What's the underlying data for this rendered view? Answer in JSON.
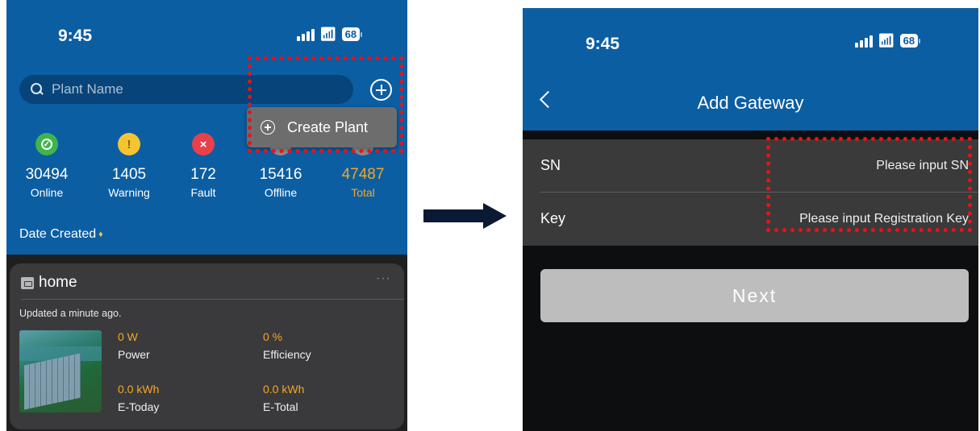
{
  "colors": {
    "brand_blue": "#0c5ea3",
    "online": "#3db54a",
    "warning": "#f4c531",
    "fault": "#e8404b",
    "total_accent": "#f5a623",
    "highlight": "#e8121c"
  },
  "plant_list": {
    "status_bar": {
      "time": "9:45",
      "battery": "68"
    },
    "search": {
      "placeholder": "Plant Name",
      "icon": "search-icon"
    },
    "add_button_icon": "plus-circle-icon",
    "dropdown": {
      "item_label": "Create Plant",
      "icon": "plus-circle-icon"
    },
    "stats": [
      {
        "value": "30494",
        "label": "Online",
        "icon": "check-icon",
        "glyph": "✓"
      },
      {
        "value": "1405",
        "label": "Warning",
        "icon": "warning-icon",
        "glyph": "!"
      },
      {
        "value": "172",
        "label": "Fault",
        "icon": "x-icon",
        "glyph": "×"
      },
      {
        "value": "15416",
        "label": "Offline",
        "icon": "offline-icon",
        "glyph": ""
      },
      {
        "value": "47487",
        "label": "Total",
        "icon": "total-icon",
        "glyph": ""
      }
    ],
    "sort": {
      "label": "Date Created",
      "icon": "sort-icon"
    },
    "plant_card": {
      "name": "home",
      "menu": "···",
      "updated": "Updated a minute ago.",
      "metrics": [
        {
          "value": "0 W",
          "label": "Power"
        },
        {
          "value": "0 %",
          "label": "Efficiency"
        },
        {
          "value": "0.0 kWh",
          "label": "E-Today"
        },
        {
          "value": "0.0 kWh",
          "label": "E-Total"
        }
      ]
    }
  },
  "add_gateway": {
    "status_bar": {
      "time": "9:45",
      "battery": "68"
    },
    "title": "Add Gateway",
    "fields": [
      {
        "label": "SN",
        "placeholder": "Please input SN"
      },
      {
        "label": "Key",
        "placeholder": "Please input Registration Key"
      }
    ],
    "next_label": "Next"
  }
}
